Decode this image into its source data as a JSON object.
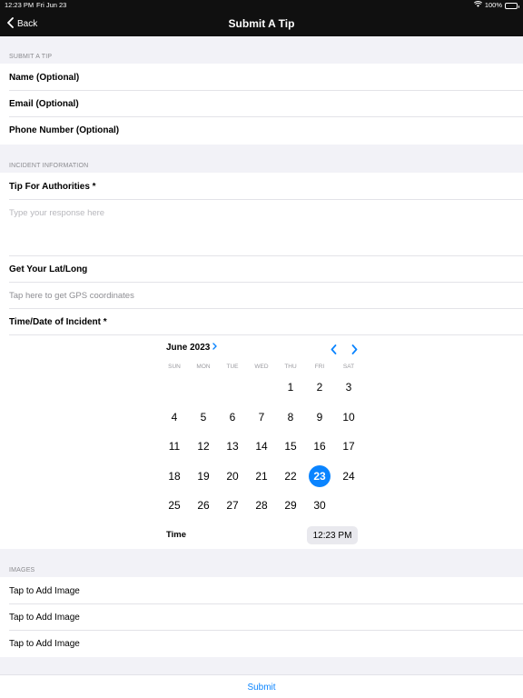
{
  "status_bar": {
    "time": "12:23 PM",
    "date": "Fri Jun 23",
    "battery": "100%",
    "wifi_icon": "wifi-icon"
  },
  "nav": {
    "back_label": "Back",
    "title": "Submit A Tip"
  },
  "section_submit": {
    "header": "SUBMIT A TIP",
    "rows": [
      "Name (Optional)",
      "Email (Optional)",
      "Phone Number (Optional)"
    ]
  },
  "section_incident": {
    "header": "INCIDENT INFORMATION",
    "tip_label": "Tip For Authorities *",
    "tip_placeholder": "Type your response here",
    "latlong_label": "Get Your Lat/Long",
    "latlong_hint": "Tap here to get GPS coordinates",
    "datetime_label": "Time/Date of Incident *"
  },
  "calendar": {
    "month_label": "June 2023",
    "weekdays": [
      "SUN",
      "MON",
      "TUE",
      "WED",
      "THU",
      "FRI",
      "SAT"
    ],
    "leading_blanks": 4,
    "days": [
      "1",
      "2",
      "3",
      "4",
      "5",
      "6",
      "7",
      "8",
      "9",
      "10",
      "11",
      "12",
      "13",
      "14",
      "15",
      "16",
      "17",
      "18",
      "19",
      "20",
      "21",
      "22",
      "23",
      "24",
      "25",
      "26",
      "27",
      "28",
      "29",
      "30"
    ],
    "selected_day": "23",
    "time_label": "Time",
    "time_value": "12:23 PM",
    "accent_color": "#0a84ff"
  },
  "section_images": {
    "header": "IMAGES",
    "rows": [
      "Tap to Add Image",
      "Tap to Add Image",
      "Tap to Add Image"
    ]
  },
  "submit_label": "Submit"
}
